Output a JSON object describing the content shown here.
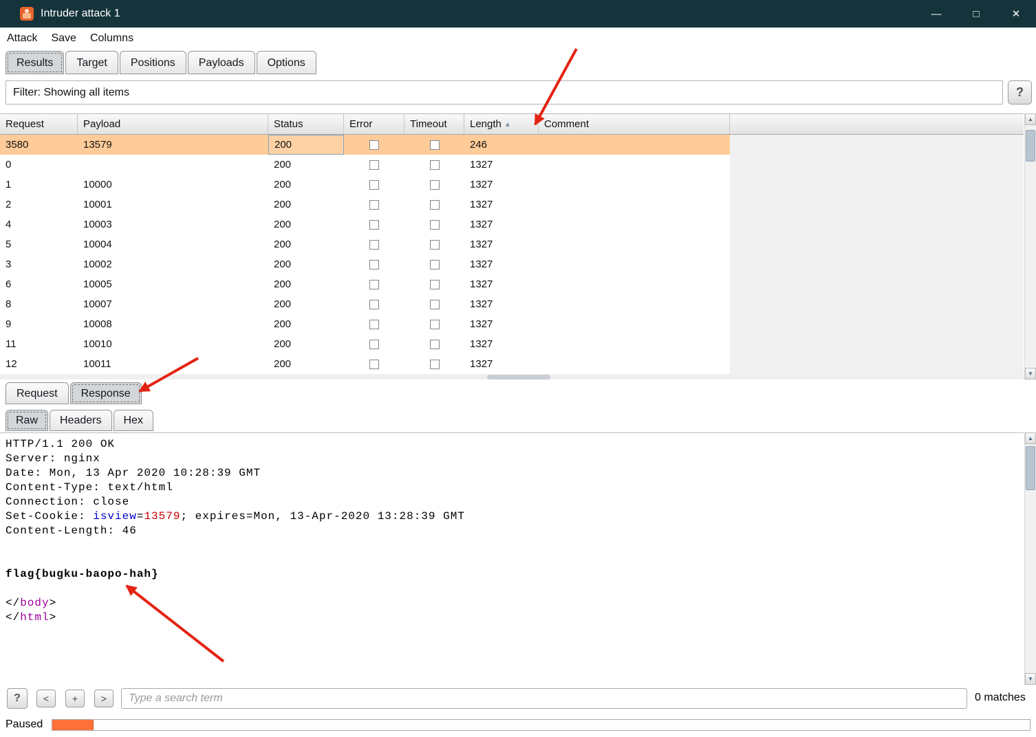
{
  "window": {
    "title": "Intruder attack 1",
    "minimize": "—",
    "maximize": "□",
    "close": "✕"
  },
  "menubar": {
    "items": [
      "Attack",
      "Save",
      "Columns"
    ]
  },
  "main_tabs": {
    "items": [
      "Results",
      "Target",
      "Positions",
      "Payloads",
      "Options"
    ],
    "selected": "Results"
  },
  "filter": {
    "label": "Filter: Showing all items",
    "help": "?"
  },
  "icons": {
    "scroll_up": "▲",
    "scroll_down": "▼",
    "sort_asc": "▴"
  },
  "results_table": {
    "columns": [
      {
        "key": "request",
        "label": "Request"
      },
      {
        "key": "payload",
        "label": "Payload"
      },
      {
        "key": "status",
        "label": "Status"
      },
      {
        "key": "error",
        "label": "Error",
        "type": "checkbox"
      },
      {
        "key": "timeout",
        "label": "Timeout",
        "type": "checkbox"
      },
      {
        "key": "length",
        "label": "Length",
        "sorted": "ascending"
      },
      {
        "key": "comment",
        "label": "Comment"
      }
    ],
    "rows": [
      {
        "request": "3580",
        "payload": "13579",
        "status": "200",
        "error": false,
        "timeout": false,
        "length": "246",
        "comment": "",
        "selected": true
      },
      {
        "request": "0",
        "payload": "",
        "status": "200",
        "error": false,
        "timeout": false,
        "length": "1327",
        "comment": ""
      },
      {
        "request": "1",
        "payload": "10000",
        "status": "200",
        "error": false,
        "timeout": false,
        "length": "1327",
        "comment": ""
      },
      {
        "request": "2",
        "payload": "10001",
        "status": "200",
        "error": false,
        "timeout": false,
        "length": "1327",
        "comment": ""
      },
      {
        "request": "4",
        "payload": "10003",
        "status": "200",
        "error": false,
        "timeout": false,
        "length": "1327",
        "comment": ""
      },
      {
        "request": "5",
        "payload": "10004",
        "status": "200",
        "error": false,
        "timeout": false,
        "length": "1327",
        "comment": ""
      },
      {
        "request": "3",
        "payload": "10002",
        "status": "200",
        "error": false,
        "timeout": false,
        "length": "1327",
        "comment": ""
      },
      {
        "request": "6",
        "payload": "10005",
        "status": "200",
        "error": false,
        "timeout": false,
        "length": "1327",
        "comment": ""
      },
      {
        "request": "8",
        "payload": "10007",
        "status": "200",
        "error": false,
        "timeout": false,
        "length": "1327",
        "comment": ""
      },
      {
        "request": "9",
        "payload": "10008",
        "status": "200",
        "error": false,
        "timeout": false,
        "length": "1327",
        "comment": ""
      },
      {
        "request": "11",
        "payload": "10010",
        "status": "200",
        "error": false,
        "timeout": false,
        "length": "1327",
        "comment": ""
      },
      {
        "request": "12",
        "payload": "10011",
        "status": "200",
        "error": false,
        "timeout": false,
        "length": "1327",
        "comment": ""
      }
    ]
  },
  "message_tabs": {
    "items": [
      "Request",
      "Response"
    ],
    "selected": "Response"
  },
  "view_tabs": {
    "items": [
      "Raw",
      "Headers",
      "Hex"
    ],
    "selected": "Raw"
  },
  "response_view": {
    "colors": {
      "name": "#0000cc",
      "value": "#cc0000",
      "tag": "#990099"
    },
    "lines": [
      [
        {
          "t": "HTTP/1.1 200 OK"
        }
      ],
      [
        {
          "t": "Server: nginx"
        }
      ],
      [
        {
          "t": "Date: Mon, 13 Apr 2020 10:28:39 GMT"
        }
      ],
      [
        {
          "t": "Content-Type: text/html"
        }
      ],
      [
        {
          "t": "Connection: close"
        }
      ],
      [
        {
          "t": "Set-Cookie: "
        },
        {
          "t": "isview",
          "c": "name"
        },
        {
          "t": "="
        },
        {
          "t": "13579",
          "c": "value"
        },
        {
          "t": "; expires=Mon, 13-Apr-2020 13:28:39 GMT"
        }
      ],
      [
        {
          "t": "Content-Length: 46"
        }
      ],
      [],
      [],
      [
        {
          "t": "flag{bugku-baopo-hah}",
          "b": true
        }
      ],
      [],
      [
        {
          "t": "</"
        },
        {
          "t": "body",
          "c": "tag"
        },
        {
          "t": ">"
        }
      ],
      [
        {
          "t": "</"
        },
        {
          "t": "html",
          "c": "tag"
        },
        {
          "t": ">"
        }
      ]
    ]
  },
  "search_bar": {
    "help": "?",
    "prev": "<",
    "add": "+",
    "next": ">",
    "placeholder": "Type a search term",
    "matches": "0 matches"
  },
  "status_bar": {
    "label": "Paused",
    "progress_fraction": 0.042
  }
}
